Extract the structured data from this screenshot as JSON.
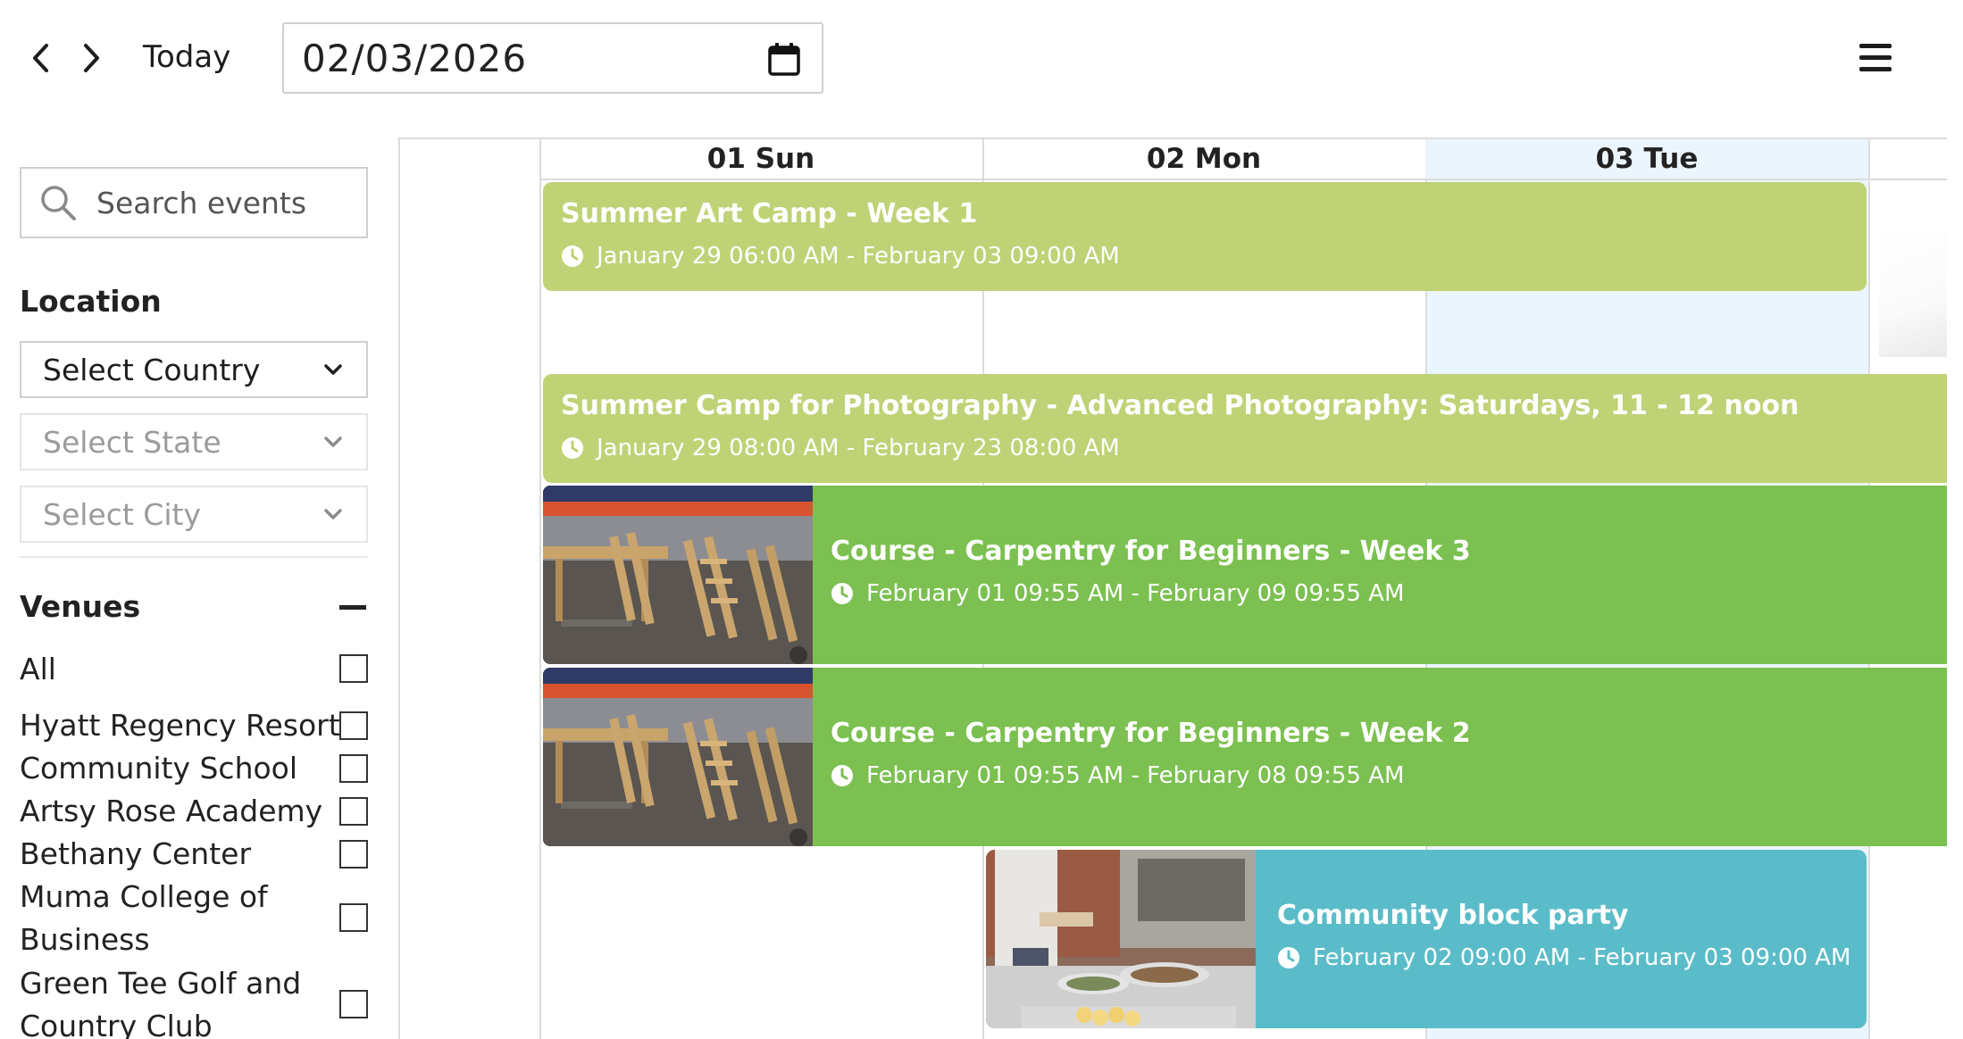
{
  "toolbar": {
    "today_label": "Today",
    "date_value": "02/03/2026",
    "icons": {
      "prev": "chevron-left-icon",
      "next": "chevron-right-icon",
      "calendar": "calendar-icon",
      "menu": "hamburger-menu-icon"
    }
  },
  "sidebar": {
    "search_placeholder": "Search events",
    "location_title": "Location",
    "country_select": "Select Country",
    "state_select": "Select State",
    "city_select": "Select City",
    "venues_title": "Venues",
    "venues": [
      "All",
      "Hyatt Regency Resort",
      "Community School",
      "Artsy Rose Academy",
      "Bethany Center",
      "Muma College of Business",
      "Green Tee Golf and Country Club"
    ]
  },
  "calendar": {
    "days": [
      "01 Sun",
      "02 Mon",
      "03 Tue"
    ],
    "today_index": 2,
    "events": [
      {
        "title": "Summer Art Camp - Week 1",
        "time": "January 29 06:00 AM - February 03 09:00 AM",
        "color": "#bfd276"
      },
      {
        "title": "Summer Camp for Photography - Advanced Photography: Saturdays, 11 - 12 noon",
        "time": "January 29 08:00 AM - February 23 08:00 AM",
        "color": "#bfd276"
      },
      {
        "title": "Course - Carpentry for Beginners - Week 3",
        "time": "February 01 09:55 AM - February 09 09:55 AM",
        "color": "#7bc050"
      },
      {
        "title": "Course - Carpentry for Beginners - Week 2",
        "time": "February 01 09:55 AM - February 08 09:55 AM",
        "color": "#7bc050"
      },
      {
        "title": "Community block party",
        "time": "February 02 09:00 AM - February 03 09:00 AM",
        "color": "#5bbcc9"
      }
    ]
  }
}
